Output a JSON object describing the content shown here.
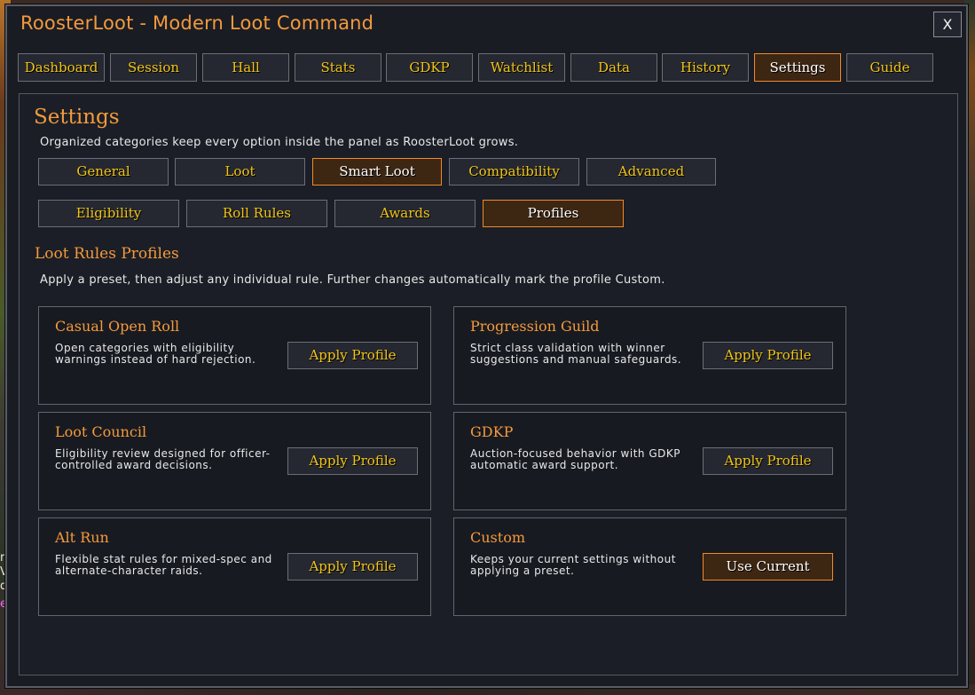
{
  "window": {
    "title": "RoosterLoot - Modern Loot Command",
    "close_label": "X"
  },
  "nav_tabs": [
    {
      "label": "Dashboard",
      "active": false
    },
    {
      "label": "Session",
      "active": false
    },
    {
      "label": "Hall",
      "active": false
    },
    {
      "label": "Stats",
      "active": false
    },
    {
      "label": "GDKP",
      "active": false
    },
    {
      "label": "Watchlist",
      "active": false
    },
    {
      "label": "Data",
      "active": false
    },
    {
      "label": "History",
      "active": false
    },
    {
      "label": "Settings",
      "active": true
    },
    {
      "label": "Guide",
      "active": false
    }
  ],
  "settings": {
    "title": "Settings",
    "description": "Organized categories keep every option inside the panel as RoosterLoot grows.",
    "categories": [
      {
        "label": "General",
        "active": false
      },
      {
        "label": "Loot",
        "active": false
      },
      {
        "label": "Smart Loot",
        "active": true
      },
      {
        "label": "Compatibility",
        "active": false
      },
      {
        "label": "Advanced",
        "active": false
      }
    ],
    "subtabs": [
      {
        "label": "Eligibility",
        "active": false
      },
      {
        "label": "Roll Rules",
        "active": false
      },
      {
        "label": "Awards",
        "active": false
      },
      {
        "label": "Profiles",
        "active": true
      }
    ]
  },
  "profiles": {
    "title": "Loot Rules Profiles",
    "description": "Apply a preset, then adjust any individual rule. Further changes automatically mark the profile Custom.",
    "cards": [
      {
        "title": "Casual Open Roll",
        "line1": "Open categories with eligibility",
        "line2": "warnings instead of hard rejection.",
        "button": "Apply Profile",
        "active": false
      },
      {
        "title": "Progression Guild",
        "line1": "Strict class validation with winner",
        "line2": "suggestions and manual safeguards.",
        "button": "Apply Profile",
        "active": false
      },
      {
        "title": "Loot Council",
        "line1": "Eligibility review designed for officer-",
        "line2": "controlled award decisions.",
        "button": "Apply Profile",
        "active": false
      },
      {
        "title": "GDKP",
        "line1": "Auction-focused behavior with GDKP",
        "line2": "automatic award support.",
        "button": "Apply Profile",
        "active": false
      },
      {
        "title": "Alt Run",
        "line1": "Flexible stat rules for mixed-spec and",
        "line2": "alternate-character raids.",
        "button": "Apply Profile",
        "active": false
      },
      {
        "title": "Custom",
        "line1": "Keeps your current settings without",
        "line2": "applying a preset.",
        "button": "Use Current",
        "active": true
      }
    ]
  },
  "background_fragments": [
    "r",
    "V",
    "d",
    "e"
  ],
  "colors": {
    "accent": "#f39a3c",
    "gold_text": "#f2c417",
    "active_border": "#f08a28",
    "panel_bg": "#1b1e26"
  }
}
